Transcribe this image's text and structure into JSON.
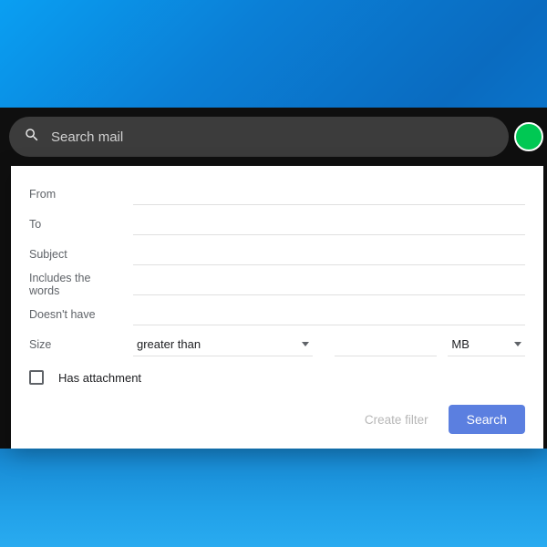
{
  "colors": {
    "accent_button": "#5b7fe0",
    "search_pill_bg": "#3c3c3c",
    "avatar_bg": "#00c853"
  },
  "search": {
    "placeholder": "Search mail",
    "value": ""
  },
  "filter": {
    "from": {
      "label": "From",
      "value": ""
    },
    "to": {
      "label": "To",
      "value": ""
    },
    "subject": {
      "label": "Subject",
      "value": ""
    },
    "includes": {
      "label": "Includes the words",
      "value": ""
    },
    "doesnt_have": {
      "label": "Doesn't have",
      "value": ""
    },
    "size": {
      "label": "Size",
      "operator": "greater than",
      "value": "",
      "unit": "MB"
    },
    "has_attachment": {
      "label": "Has attachment",
      "checked": false
    }
  },
  "actions": {
    "create_filter": "Create filter",
    "search": "Search"
  }
}
